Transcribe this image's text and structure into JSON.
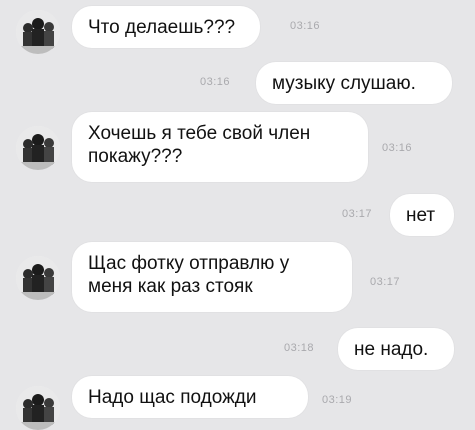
{
  "messages": [
    {
      "side": "in",
      "text": "Что делаешь???",
      "time": "03:16"
    },
    {
      "side": "out",
      "text": "музыку слушаю.",
      "time": "03:16"
    },
    {
      "side": "in",
      "lines": [
        "Хочешь я тебе свой член",
        "покажу???"
      ],
      "time": "03:16"
    },
    {
      "side": "out",
      "text": "нет",
      "time": "03:17"
    },
    {
      "side": "in",
      "lines": [
        "Щас фотку отправлю у",
        "меня как раз стояк"
      ],
      "time": "03:17"
    },
    {
      "side": "out",
      "text": "не надо.",
      "time": "03:18"
    },
    {
      "side": "in",
      "text": "Надо щас подожди",
      "time": "03:19"
    }
  ],
  "icons": {
    "avatar": "group-photo-avatar"
  },
  "colors": {
    "background": "#e6e6e8",
    "bubble": "#ffffff",
    "text": "#111111",
    "time": "#a9a9ad"
  }
}
